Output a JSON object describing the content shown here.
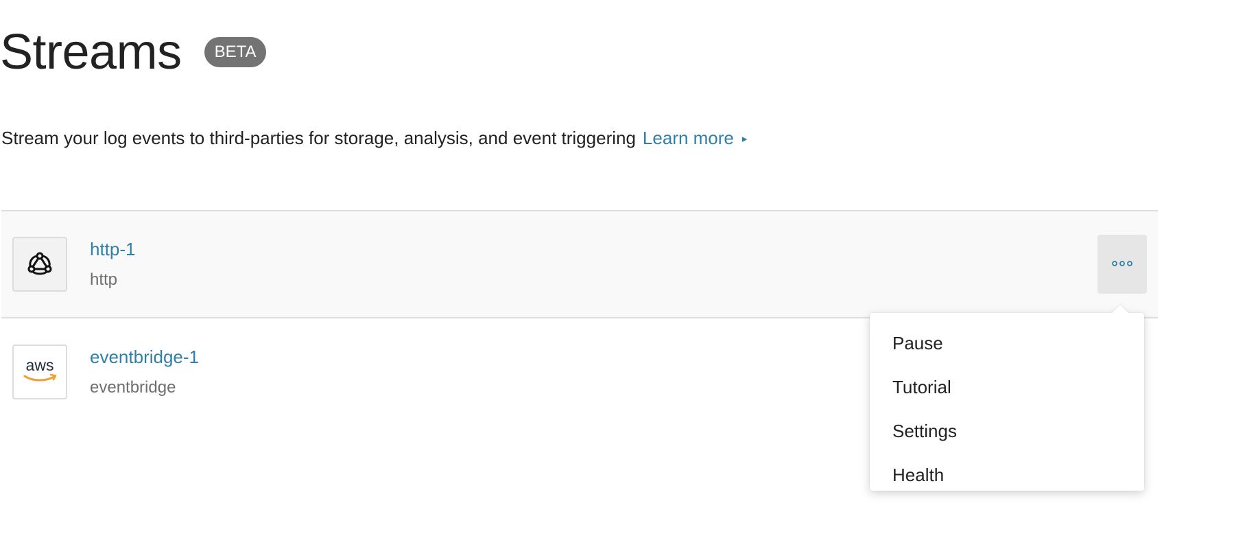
{
  "header": {
    "title": "Streams",
    "badge": "BETA"
  },
  "intro": {
    "text": "Stream your log events to third-parties for storage, analysis, and event triggering",
    "learn_more": "Learn more",
    "learn_more_arrow": "▸"
  },
  "streams": [
    {
      "name": "http-1",
      "type": "http",
      "icon": "webhook-icon",
      "highlighted": true
    },
    {
      "name": "eventbridge-1",
      "type": "eventbridge",
      "icon": "aws-logo",
      "logo_text": "aws",
      "highlighted": false
    }
  ],
  "row_menu": {
    "open_for": "http-1",
    "items": [
      "Pause",
      "Tutorial",
      "Settings",
      "Health"
    ]
  },
  "colors": {
    "link": "#2f80a8",
    "badge_bg": "#737373",
    "aws_smile": "#f0a030",
    "row_highlight": "#f9f9f9"
  }
}
